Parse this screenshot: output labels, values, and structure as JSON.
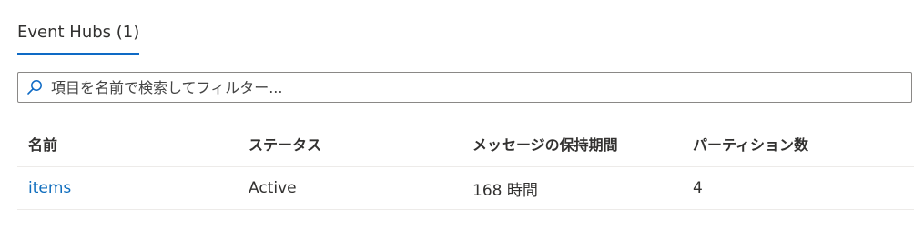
{
  "tabs": [
    {
      "label": "Event Hubs (1)",
      "active": true
    }
  ],
  "search": {
    "placeholder": "項目を名前で検索してフィルター...",
    "value": ""
  },
  "table": {
    "headers": [
      "名前",
      "ステータス",
      "メッセージの保持期間",
      "パーティション数"
    ],
    "rows": [
      {
        "name": "items",
        "status": "Active",
        "retention": "168 時間",
        "partitions": "4"
      }
    ]
  },
  "colors": {
    "accent": "#0e6ac5",
    "link": "#106ebe",
    "text": "#323130",
    "border": "#8a8886",
    "row_divider": "#edebe9"
  },
  "icons": {
    "search": "search-icon"
  }
}
